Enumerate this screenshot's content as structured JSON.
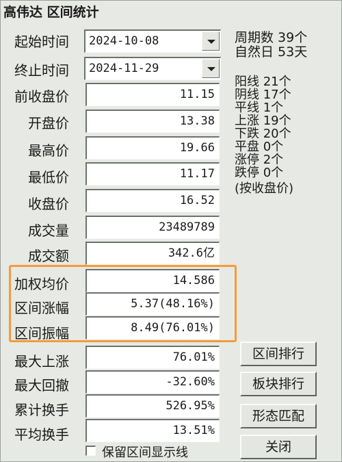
{
  "window": {
    "title": "高伟达 区间统计"
  },
  "dates": {
    "start_label": "起始时间",
    "start_value": "2024-10-08",
    "end_label": "终止时间",
    "end_value": "2024-11-29"
  },
  "stats": [
    {
      "label": "前收盘价",
      "value": "11.15"
    },
    {
      "label": "开盘价",
      "value": "13.38"
    },
    {
      "label": "最高价",
      "value": "19.66"
    },
    {
      "label": "最低价",
      "value": "11.17"
    },
    {
      "label": "收盘价",
      "value": "16.52"
    },
    {
      "label": "成交量",
      "value": "23489789"
    },
    {
      "label": "成交额",
      "value": "342.6亿"
    },
    {
      "label": "加权均价",
      "value": "14.586"
    },
    {
      "label": "区间涨幅",
      "value": "5.37(48.16%)"
    },
    {
      "label": "区间振幅",
      "value": "8.49(76.01%)"
    },
    {
      "label": "最大上涨",
      "value": "76.01%"
    },
    {
      "label": "最大回撤",
      "value": "-32.60%"
    },
    {
      "label": "累计换手",
      "value": "526.95%"
    },
    {
      "label": "平均换手",
      "value": "13.51%"
    }
  ],
  "period": {
    "line1": "周期数 39个",
    "line2": "自然日 53天"
  },
  "counts": [
    "阳线 21个",
    "阴线 17个",
    "平线 1个",
    "上涨 19个",
    "下跌 20个",
    "平盘 0个",
    "涨停 2个",
    "跌停 0个",
    "(按收盘价)"
  ],
  "buttons": {
    "interval_rank": "区间排行",
    "sector_rank": "板块排行",
    "pattern_match": "形态匹配",
    "close": "关闭"
  },
  "checkbox": {
    "label": "保留区间显示线",
    "checked": false
  },
  "colors": {
    "highlight": "#f59a3a",
    "background": "#e7e9e5"
  }
}
